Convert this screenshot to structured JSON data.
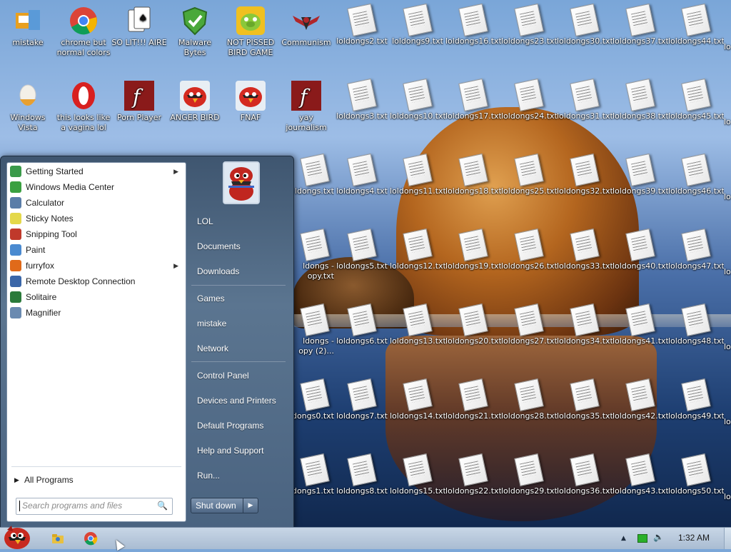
{
  "desktop": {
    "icons": [
      {
        "label": "mistake",
        "kind": "app",
        "color": "#f0b040"
      },
      {
        "label": "chrome but normal colors",
        "kind": "chrome"
      },
      {
        "label": "SO LIT!!! AIRE",
        "kind": "cards"
      },
      {
        "label": "Malware Bytes",
        "kind": "shield"
      },
      {
        "label": "NOT PISSED BIRD GAME",
        "kind": "pig"
      },
      {
        "label": "Communism",
        "kind": "commie"
      },
      {
        "label": "Windows Vista",
        "kind": "egg"
      },
      {
        "label": "this looks like a vagina lol",
        "kind": "opera"
      },
      {
        "label": "Porn Player",
        "kind": "flash"
      },
      {
        "label": "ANGER BIRD",
        "kind": "bird"
      },
      {
        "label": "FNAF",
        "kind": "bird"
      },
      {
        "label": "yay journalism",
        "kind": "flash"
      }
    ],
    "partial_labels": [
      "ldongs.txt",
      "ldongs -",
      "opy.txt",
      "ldongs -",
      "opy (2)...",
      "dongs0.txt",
      "ldongs1.txt"
    ],
    "txt_files_col": [
      [
        "loldongs2.txt",
        "loldongs3.txt",
        "loldongs4.txt",
        "loldongs5.txt",
        "loldongs6.txt",
        "loldongs7.txt",
        "loldongs8.txt"
      ],
      [
        "loldongs9.txt",
        "loldongs10.txt",
        "loldongs11.txt",
        "loldongs12.txt",
        "loldongs13.txt",
        "loldongs14.txt",
        "loldongs15.txt"
      ],
      [
        "loldongs16.txt",
        "loldongs17.txt",
        "loldongs18.txt",
        "loldongs19.txt",
        "loldongs20.txt",
        "loldongs21.txt",
        "loldongs22.txt"
      ],
      [
        "loldongs23.txt",
        "loldongs24.txt",
        "loldongs25.txt",
        "loldongs26.txt",
        "loldongs27.txt",
        "loldongs28.txt",
        "loldongs29.txt"
      ],
      [
        "loldongs30.txt",
        "loldongs31.txt",
        "loldongs32.txt",
        "loldongs33.txt",
        "loldongs34.txt",
        "loldongs35.txt",
        "loldongs36.txt"
      ],
      [
        "loldongs37.txt",
        "loldongs38.txt",
        "loldongs39.txt",
        "loldongs40.txt",
        "loldongs41.txt",
        "loldongs42.txt",
        "loldongs43.txt"
      ],
      [
        "loldongs44.txt",
        "loldongs45.txt",
        "loldongs46.txt",
        "loldongs47.txt",
        "loldongs48.txt",
        "loldongs49.txt",
        "loldongs50.txt"
      ]
    ],
    "edge_label_fragment": "lo"
  },
  "start_menu": {
    "programs": [
      {
        "label": "Getting Started",
        "has_submenu": true,
        "icon": "getting-started-icon",
        "color": "#3a9a4a"
      },
      {
        "label": "Windows Media Center",
        "has_submenu": false,
        "icon": "media-center-icon",
        "color": "#3aa040"
      },
      {
        "label": "Calculator",
        "has_submenu": false,
        "icon": "calculator-icon",
        "color": "#5a7da8"
      },
      {
        "label": "Sticky Notes",
        "has_submenu": false,
        "icon": "sticky-notes-icon",
        "color": "#e4d84a"
      },
      {
        "label": "Snipping Tool",
        "has_submenu": false,
        "icon": "scissors-icon",
        "color": "#c0392b"
      },
      {
        "label": "Paint",
        "has_submenu": false,
        "icon": "paint-icon",
        "color": "#4a8ad0"
      },
      {
        "label": "furryfox",
        "has_submenu": true,
        "icon": "firefox-icon",
        "color": "#e06a1a"
      },
      {
        "label": "Remote Desktop Connection",
        "has_submenu": false,
        "icon": "remote-desktop-icon",
        "color": "#3a66a8"
      },
      {
        "label": "Solitaire",
        "has_submenu": false,
        "icon": "solitaire-icon",
        "color": "#2a7a3a"
      },
      {
        "label": "Magnifier",
        "has_submenu": false,
        "icon": "magnifier-icon",
        "color": "#6a8ab0"
      }
    ],
    "all_programs": "All Programs",
    "search_placeholder": "Search programs and files",
    "right_items": [
      "LOL",
      "Documents",
      "Downloads",
      "Games",
      "mistake",
      "Network",
      "Control Panel",
      "Devices and Printers",
      "Default Programs",
      "Help and Support",
      "Run..."
    ],
    "shutdown_label": "Shut down"
  },
  "taskbar": {
    "clock": "1:32 AM"
  }
}
